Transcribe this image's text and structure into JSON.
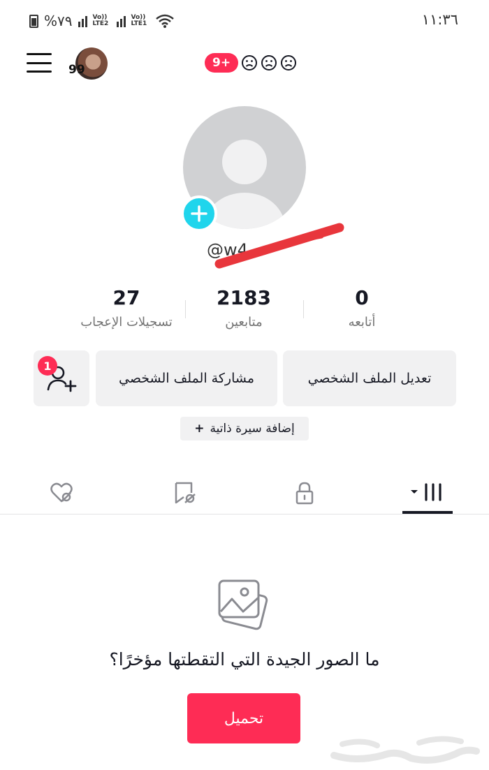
{
  "status_bar": {
    "battery": "%٧٩",
    "network_1": "Vo)) LTE2",
    "network_2": "Vo)) LTE1",
    "time": "١١:٣٦"
  },
  "header": {
    "avatar_count": "99",
    "notification_count": "9+",
    "icons": [
      "menu-icon",
      "sad-face-icon",
      "sad-face-icon",
      "sad-face-icon"
    ]
  },
  "profile": {
    "username": "@w4",
    "stats": [
      {
        "value": "27",
        "label": "تسجيلات الإعجاب"
      },
      {
        "value": "2183",
        "label": "متابعين"
      },
      {
        "value": "0",
        "label": "أتابعه"
      }
    ],
    "edit_profile_label": "تعديل الملف الشخصي",
    "share_profile_label": "مشاركة الملف الشخصي",
    "friends_badge": "1",
    "add_bio_label": "إضافة سيرة ذاتية",
    "add_bio_plus": "+"
  },
  "tabs": [
    "videos-grid-icon",
    "lock-icon",
    "hidden-reposts-icon",
    "hidden-likes-icon"
  ],
  "empty_state": {
    "message": "ما الصور الجيدة التي التقطتها مؤخرًا؟",
    "upload_label": "تحميل"
  },
  "colors": {
    "accent": "#fe2c55",
    "add_photo": "#20d5ec",
    "button_bg": "#f1f1f2"
  }
}
